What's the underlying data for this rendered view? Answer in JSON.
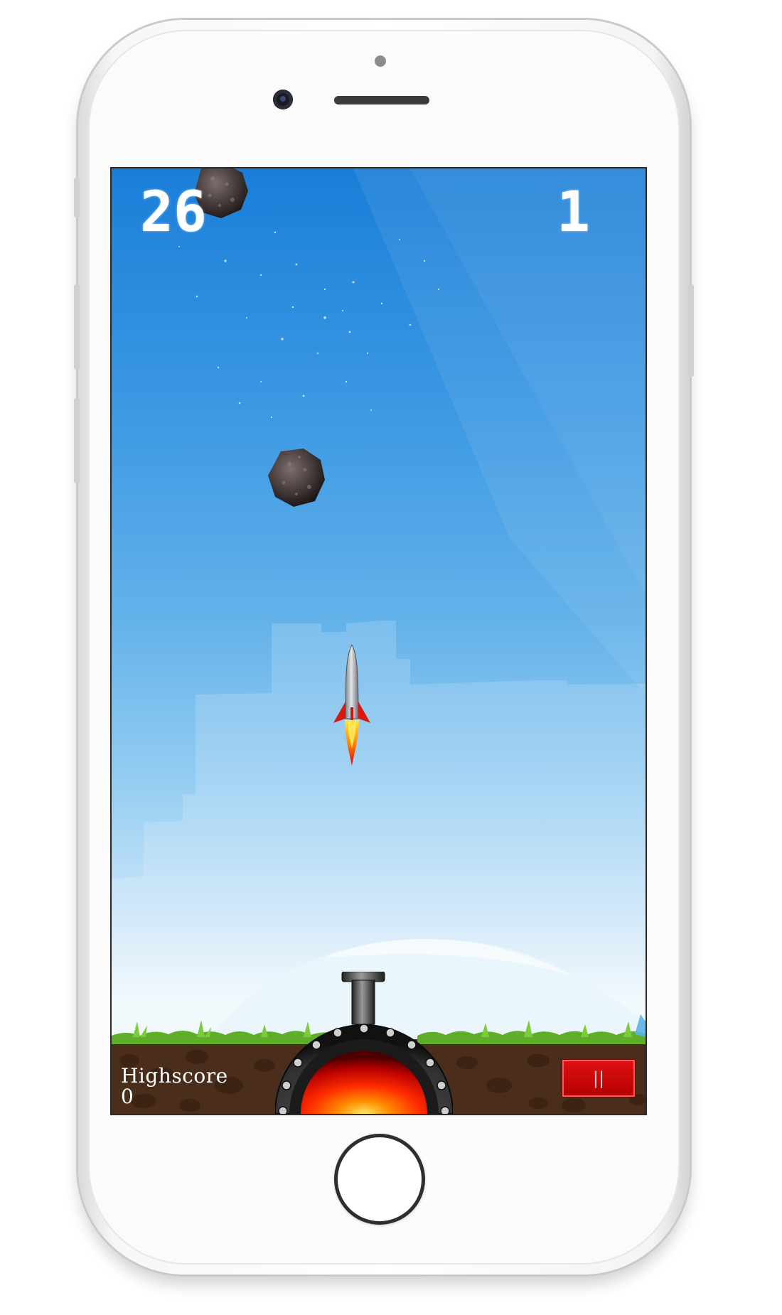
{
  "game": {
    "score": "26",
    "level": "1",
    "highscore_label": "Highscore",
    "highscore_value": "0",
    "pause_label": "||"
  },
  "icons": {
    "asteroid": "asteroid-icon",
    "rocket": "rocket-icon",
    "cannon": "cannon-icon",
    "pause": "pause-icon"
  },
  "colors": {
    "sky_top": "#1a7ed8",
    "sky_bottom": "#f0f8fd",
    "grass": "#5fae2a",
    "soil": "#4a2d1a",
    "pause_button": "#d40000",
    "cannon_core": "#ff2a00"
  }
}
